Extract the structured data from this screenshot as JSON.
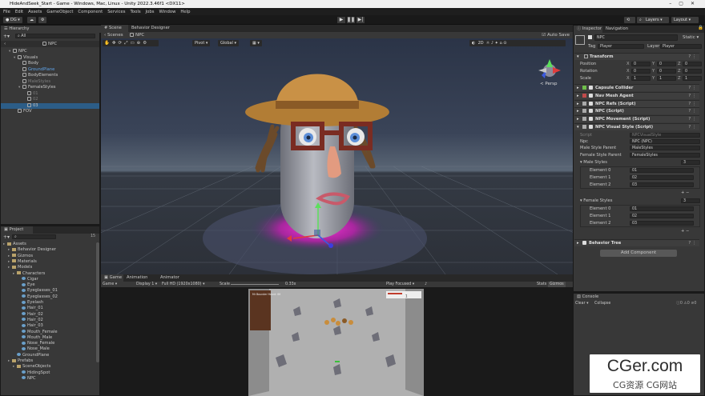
{
  "window": {
    "title": "HideAndSeek_Start - Game - Windows, Mac, Linux - Unity 2022.3.46f1 <DX11>"
  },
  "menu": [
    "File",
    "Edit",
    "Assets",
    "GameObject",
    "Component",
    "Services",
    "Tools",
    "Jobs",
    "Window",
    "Help"
  ],
  "toolbar": {
    "account": "DG",
    "layers": "Layers",
    "layout": "Layout"
  },
  "hierarchy": {
    "title": "Hierarchy",
    "search_placeholder": "All",
    "scene": "NPC",
    "items": [
      {
        "label": "NPC",
        "indent": 1,
        "style": "normal"
      },
      {
        "label": "Visuals",
        "indent": 2,
        "style": "normal"
      },
      {
        "label": "Body",
        "indent": 3,
        "style": "normal"
      },
      {
        "label": "GroundPlane",
        "indent": 3,
        "style": "blue"
      },
      {
        "label": "BodyElements",
        "indent": 3,
        "style": "normal"
      },
      {
        "label": "MaleStyles",
        "indent": 3,
        "style": "dim"
      },
      {
        "label": "FemaleStyles",
        "indent": 3,
        "style": "normal"
      },
      {
        "label": "01",
        "indent": 4,
        "style": "dim"
      },
      {
        "label": "02",
        "indent": 4,
        "style": "dim"
      },
      {
        "label": "03",
        "indent": 4,
        "style": "selected"
      },
      {
        "label": "FOV",
        "indent": 2,
        "style": "normal"
      }
    ]
  },
  "project": {
    "title": "Project",
    "count": "15",
    "items": [
      {
        "label": "Assets",
        "indent": 0,
        "folder": true
      },
      {
        "label": "Behavior Designer",
        "indent": 1,
        "folder": true
      },
      {
        "label": "Gizmos",
        "indent": 1,
        "folder": true
      },
      {
        "label": "Materials",
        "indent": 1,
        "folder": true
      },
      {
        "label": "Models",
        "indent": 1,
        "folder": true
      },
      {
        "label": "Characters",
        "indent": 2,
        "folder": true
      },
      {
        "label": "Cigar",
        "indent": 3,
        "folder": false
      },
      {
        "label": "Eye",
        "indent": 3,
        "folder": false
      },
      {
        "label": "Eyeglasses_01",
        "indent": 3,
        "folder": false
      },
      {
        "label": "Eyeglasses_02",
        "indent": 3,
        "folder": false
      },
      {
        "label": "Eyelash",
        "indent": 3,
        "folder": false
      },
      {
        "label": "Hair_01",
        "indent": 3,
        "folder": false
      },
      {
        "label": "Hair_02",
        "indent": 3,
        "folder": false
      },
      {
        "label": "Hair_02",
        "indent": 3,
        "folder": false
      },
      {
        "label": "Hair_03",
        "indent": 3,
        "folder": false
      },
      {
        "label": "Mouth_Female",
        "indent": 3,
        "folder": false
      },
      {
        "label": "Mouth_Male",
        "indent": 3,
        "folder": false
      },
      {
        "label": "Nose_Female",
        "indent": 3,
        "folder": false
      },
      {
        "label": "Nose_Male",
        "indent": 3,
        "folder": false
      },
      {
        "label": "GroundPlane",
        "indent": 2,
        "folder": false
      },
      {
        "label": "Prefabs",
        "indent": 1,
        "folder": true
      },
      {
        "label": "SceneObjects",
        "indent": 2,
        "folder": true
      },
      {
        "label": "HidingSpot",
        "indent": 3,
        "folder": false
      },
      {
        "label": "NPC",
        "indent": 3,
        "folder": false
      }
    ]
  },
  "scene": {
    "tabs": [
      "Scene",
      "Behavior Designer"
    ],
    "breadcrumb": "NPC",
    "pivot": "Pivot",
    "global": "Global",
    "auto_save": "Auto Save",
    "persp": "< Persp",
    "view_mode": "2D"
  },
  "game": {
    "tabs": [
      "Game",
      "Animation",
      "Animator"
    ],
    "display_mode": "Game",
    "display": "Display 1",
    "resolution": "Full HD (1920x1080)",
    "scale_label": "Scale",
    "scale_value": "0.33x",
    "play_focused": "Play Focused",
    "stats": "Stats",
    "gizmos": "Gizmos",
    "hud_text": "Mr Bounder\nHeard: 66",
    "counter": "1"
  },
  "console": {
    "title": "Console",
    "clear": "Clear",
    "collapse": "Collapse",
    "counts": [
      "0",
      "0",
      "0"
    ]
  },
  "inspector": {
    "tabs": [
      "Inspector",
      "Navigation"
    ],
    "object_name": "NPC",
    "static": "Static",
    "tag_label": "Tag",
    "tag": "Player",
    "layer_label": "Layer",
    "layer": "Player",
    "transform": {
      "title": "Transform",
      "rows": [
        {
          "label": "Position",
          "x": "0",
          "y": "0",
          "z": "0"
        },
        {
          "label": "Rotation",
          "x": "0",
          "y": "0",
          "z": "0"
        },
        {
          "label": "Scale",
          "x": "1",
          "y": "1",
          "z": "1"
        }
      ]
    },
    "components": [
      "Capsule Collider",
      "Nav Mesh Agent",
      "NPC Refs (Script)",
      "NPC (Script)",
      "NPC Movement (Script)",
      "NPC Visual Style (Script)"
    ],
    "visual_style": {
      "script_label": "Script",
      "script": "NPCVisualStyle",
      "npc_label": "Npc",
      "npc": "NPC (NPC)",
      "male_parent_label": "Male Style Parent",
      "male_parent": "MaleStyles",
      "female_parent_label": "Female Style Parent",
      "female_parent": "FemaleStyles",
      "male_styles_label": "Male Styles",
      "male_count": "3",
      "male": [
        {
          "label": "Element 0",
          "value": "01"
        },
        {
          "label": "Element 1",
          "value": "02"
        },
        {
          "label": "Element 2",
          "value": "03"
        }
      ],
      "female_styles_label": "Female Styles",
      "female_count": "3",
      "female": [
        {
          "label": "Element 0",
          "value": "01"
        },
        {
          "label": "Element 1",
          "value": "02"
        },
        {
          "label": "Element 2",
          "value": "03"
        }
      ]
    },
    "behavior_tree": "Behavior Tree",
    "add_component": "Add Component"
  },
  "watermark": {
    "main": "CGer.com",
    "sub": "CG资源 CG网站"
  },
  "colors": {
    "accent": "#2c5d87",
    "hat": "#c08a3e",
    "glasses": "#7a2c22",
    "glow": "#ff2fd0"
  }
}
